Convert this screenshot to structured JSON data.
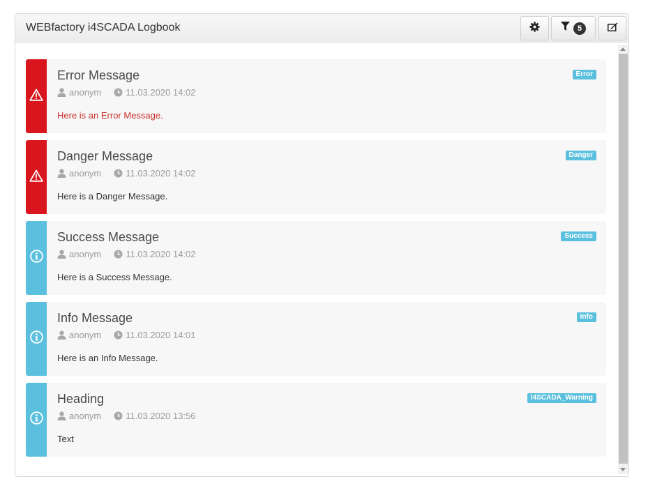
{
  "header": {
    "title": "WEBfactory i4SCADA Logbook",
    "settings_icon": "gear-icon",
    "filter_icon": "filter-icon",
    "filter_count": "5",
    "edit_icon": "edit-icon"
  },
  "colors": {
    "error": "#d9161d",
    "info": "#5bc0de",
    "error_text": "#c9302c",
    "badge": "#5bc0de"
  },
  "entries": [
    {
      "title": "Error Message",
      "user": "anonym",
      "time": "11.03.2020 14:02",
      "body": "Here is an Error Message.",
      "badge": "Error",
      "icon": "warning-icon",
      "severity": "error"
    },
    {
      "title": "Danger Message",
      "user": "anonym",
      "time": "11.03.2020 14:02",
      "body": "Here is a Danger Message.",
      "badge": "Danger",
      "icon": "warning-icon",
      "severity": "error"
    },
    {
      "title": "Success Message",
      "user": "anonym",
      "time": "11.03.2020 14:02",
      "body": "Here is a Success Message.",
      "badge": "Success",
      "icon": "info-icon",
      "severity": "info"
    },
    {
      "title": "Info Message",
      "user": "anonym",
      "time": "11.03.2020 14:01",
      "body": "Here is an Info Message.",
      "badge": "Info",
      "icon": "info-icon",
      "severity": "info"
    },
    {
      "title": "Heading",
      "user": "anonym",
      "time": "11.03.2020 13:56",
      "body": "Text",
      "badge": "I4SCADA_Warning",
      "icon": "info-icon",
      "severity": "info"
    }
  ]
}
